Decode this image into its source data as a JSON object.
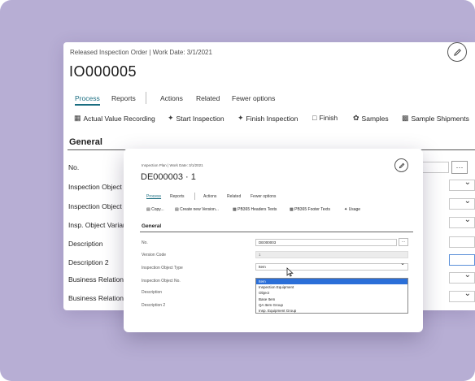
{
  "back_window": {
    "header": "Released Inspection Order | Work Date: 3/1/2021",
    "title": "IO000005",
    "edit_icon": "pencil-icon",
    "nav": {
      "process": "Process",
      "reports": "Reports",
      "actions": "Actions",
      "related": "Related",
      "fewer_options": "Fewer options"
    },
    "actions": [
      {
        "icon": "recording-icon",
        "label": "Actual Value Recording"
      },
      {
        "icon": "start-icon",
        "label": "Start Inspection"
      },
      {
        "icon": "finish-inspection-icon",
        "label": "Finish Inspection"
      },
      {
        "icon": "finish-icon",
        "label": "Finish"
      },
      {
        "icon": "samples-icon",
        "label": "Samples"
      },
      {
        "icon": "shipments-icon",
        "label": "Sample Shipments"
      }
    ],
    "section_title": "General",
    "fields": [
      "No.",
      "Inspection Object",
      "Inspection Object",
      "Insp. Object Varian",
      "Description",
      "Description 2",
      "Business Relation T",
      "Business Relation I"
    ],
    "dots_button": "···"
  },
  "front_window": {
    "header": "Inspection Plan | Work Date: 3/1/2021",
    "title": "DE000003 · 1",
    "edit_icon": "pencil-icon",
    "nav": {
      "process": "Process",
      "reports": "Reports",
      "actions": "Actions",
      "related": "Related",
      "fewer_options": "Fewer options"
    },
    "actions": [
      {
        "icon": "copy-icon",
        "label": "Copy..."
      },
      {
        "icon": "new-version-icon",
        "label": "Create new Version..."
      },
      {
        "icon": "headers-texts-icon",
        "label": "PB365 Headers Texts"
      },
      {
        "icon": "footer-texts-icon",
        "label": "PB365 Footer Texts"
      },
      {
        "icon": "usage-icon",
        "label": "Usage"
      }
    ],
    "section_title": "General",
    "fields": {
      "no": {
        "label": "No.",
        "value": "DE000003"
      },
      "version_code": {
        "label": "Version Code",
        "value": "1"
      },
      "inspection_object_type": {
        "label": "Inspection Object Type",
        "value": "Item"
      },
      "inspection_object_no": {
        "label": "Inspection Object No."
      },
      "description": {
        "label": "Description"
      },
      "description_2": {
        "label": "Description 2"
      }
    },
    "dots_button": "···",
    "dropdown_options": [
      {
        "label": "Item",
        "selected": true
      },
      {
        "label": "Inspection Equipment",
        "selected": false
      },
      {
        "label": "Object",
        "selected": false
      },
      {
        "label": "Base Item",
        "selected": false
      },
      {
        "label": "QA Item Group",
        "selected": false
      },
      {
        "label": "Insp. Equipment Group",
        "selected": false
      }
    ]
  },
  "colors": {
    "background": "#b7aed4",
    "accent": "#1a6d80",
    "dropdown_selected": "#2b6fd8"
  }
}
